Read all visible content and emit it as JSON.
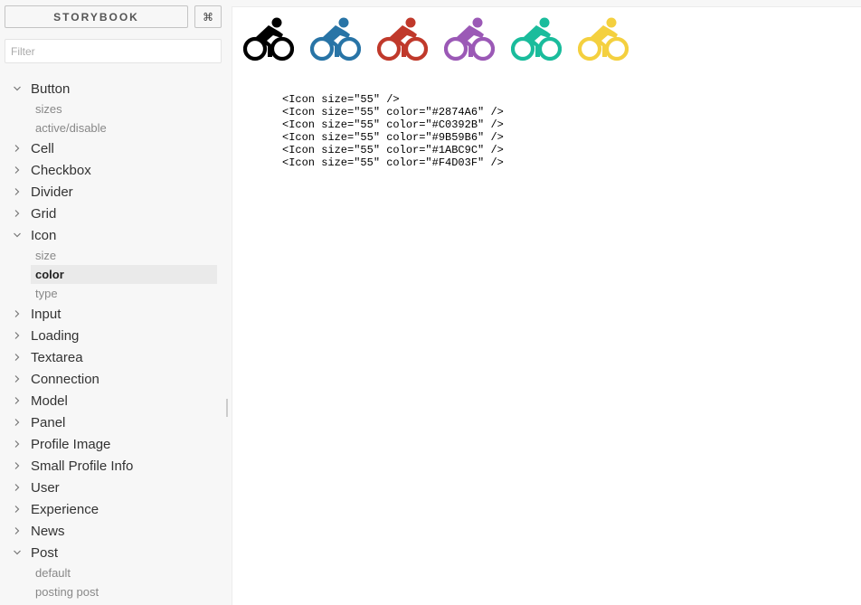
{
  "sidebar": {
    "brand": "STORYBOOK",
    "shortcut_symbol": "⌘",
    "filter_placeholder": "Filter",
    "tree": [
      {
        "label": "Button",
        "expanded": true,
        "stories": [
          {
            "label": "sizes"
          },
          {
            "label": "active/disable"
          }
        ]
      },
      {
        "label": "Cell",
        "expanded": false
      },
      {
        "label": "Checkbox",
        "expanded": false
      },
      {
        "label": "Divider",
        "expanded": false
      },
      {
        "label": "Grid",
        "expanded": false
      },
      {
        "label": "Icon",
        "expanded": true,
        "stories": [
          {
            "label": "size"
          },
          {
            "label": "color",
            "selected": true
          },
          {
            "label": "type"
          }
        ]
      },
      {
        "label": "Input",
        "expanded": false
      },
      {
        "label": "Loading",
        "expanded": false
      },
      {
        "label": "Textarea",
        "expanded": false
      },
      {
        "label": "Connection",
        "expanded": false
      },
      {
        "label": "Model",
        "expanded": false
      },
      {
        "label": "Panel",
        "expanded": false
      },
      {
        "label": "Profile Image",
        "expanded": false
      },
      {
        "label": "Small Profile Info",
        "expanded": false
      },
      {
        "label": "User",
        "expanded": false
      },
      {
        "label": "Experience",
        "expanded": false
      },
      {
        "label": "News",
        "expanded": false
      },
      {
        "label": "Post",
        "expanded": true,
        "stories": [
          {
            "label": "default"
          },
          {
            "label": "posting post"
          }
        ]
      }
    ]
  },
  "preview": {
    "icons": [
      {
        "icon": "bicycle-icon",
        "color": "#000000"
      },
      {
        "icon": "bicycle-icon",
        "color": "#2874A6"
      },
      {
        "icon": "bicycle-icon",
        "color": "#C0392B"
      },
      {
        "icon": "bicycle-icon",
        "color": "#9B59B6"
      },
      {
        "icon": "bicycle-icon",
        "color": "#1ABC9C"
      },
      {
        "icon": "bicycle-icon",
        "color": "#F4D03F"
      }
    ],
    "code_lines": [
      "<Icon size=\"55\" />",
      "<Icon size=\"55\" color=\"#2874A6\" />",
      "<Icon size=\"55\" color=\"#C0392B\" />",
      "<Icon size=\"55\" color=\"#9B59B6\" />",
      "<Icon size=\"55\" color=\"#1ABC9C\" />",
      "<Icon size=\"55\" color=\"#F4D03F\" />"
    ]
  }
}
